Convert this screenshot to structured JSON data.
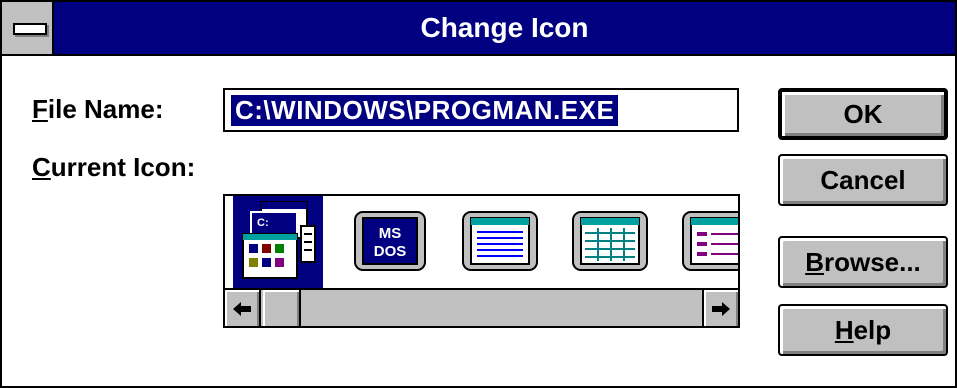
{
  "window": {
    "title": "Change Icon",
    "system_menu_icon": "system-menu-icon"
  },
  "form": {
    "file_name_label": "File Name:",
    "file_name_value": "C:\\WINDOWS\\PROGMAN.EXE",
    "current_icon_label": "Current Icon:"
  },
  "buttons": {
    "ok": "OK",
    "cancel": "Cancel",
    "browse": "Browse...",
    "help": "Help"
  },
  "icons": [
    {
      "name": "program-group-icon",
      "selected": true
    },
    {
      "name": "ms-dos-icon",
      "text_top": "MS",
      "text_bottom": "DOS",
      "selected": false
    },
    {
      "name": "window-lines-icon",
      "selected": false
    },
    {
      "name": "window-grid-icon",
      "selected": false
    },
    {
      "name": "window-list-icon",
      "selected": false
    }
  ],
  "scrollbar": {
    "left_arrow": "left-arrow-icon",
    "right_arrow": "right-arrow-icon"
  },
  "colors": {
    "titlebar": "#000080",
    "face": "#c0c0c0",
    "selection": "#000080"
  }
}
